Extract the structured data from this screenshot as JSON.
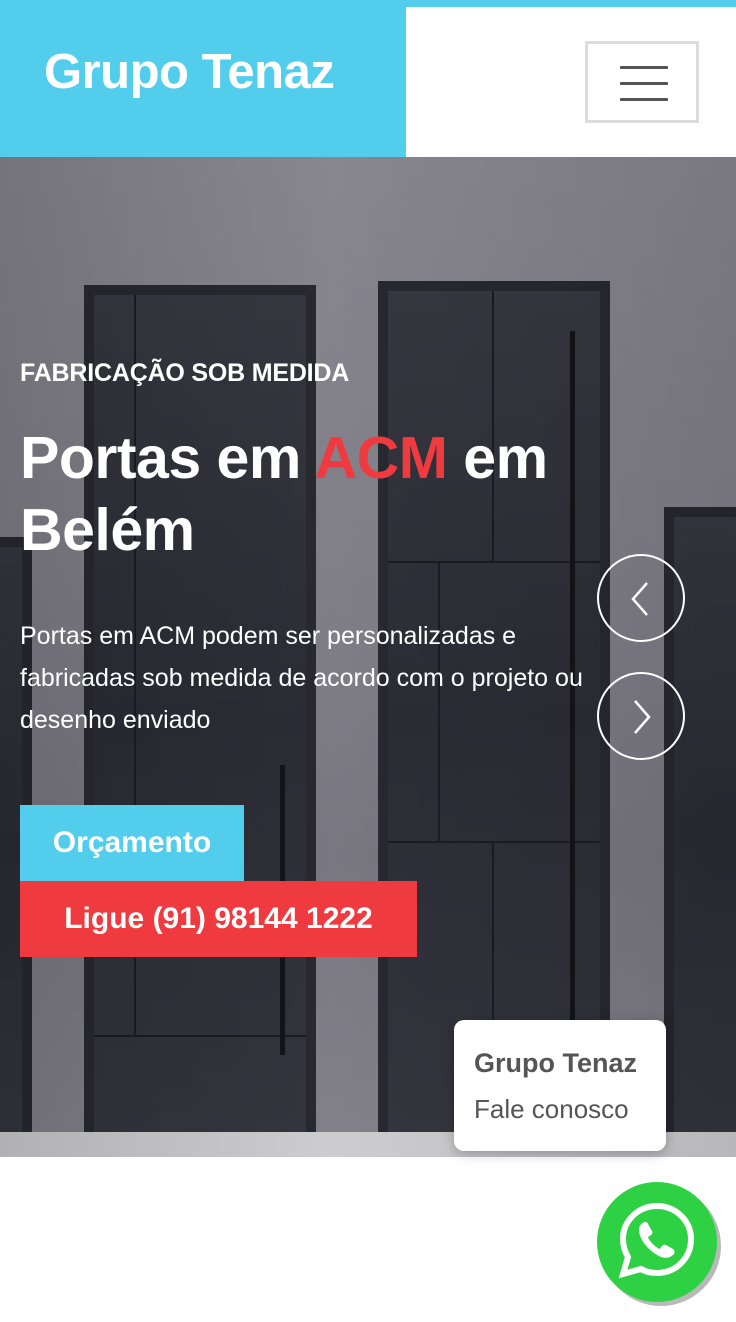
{
  "header": {
    "brand": "Grupo Tenaz",
    "menu_icon": "hamburger-menu-icon"
  },
  "hero": {
    "eyebrow": "FABRICAÇÃO SOB MEDIDA",
    "headline_part1": "Portas em ",
    "headline_accent": "ACM",
    "headline_part2": " em Belém",
    "description": "Portas em ACM podem ser personalizadas e fabricadas sob medida de acordo com o projeto ou desenho enviado",
    "btn_quote": "Orçamento",
    "btn_call": "Ligue (91) 98144 1222",
    "prev_icon": "chevron-left-icon",
    "next_icon": "chevron-right-icon"
  },
  "chat": {
    "title": "Grupo Tenaz",
    "subtitle": "Fale conosco",
    "whatsapp_icon": "whatsapp-icon"
  },
  "colors": {
    "brand": "#52cdec",
    "accent": "#ef3b3f",
    "whatsapp": "#2fd144"
  }
}
